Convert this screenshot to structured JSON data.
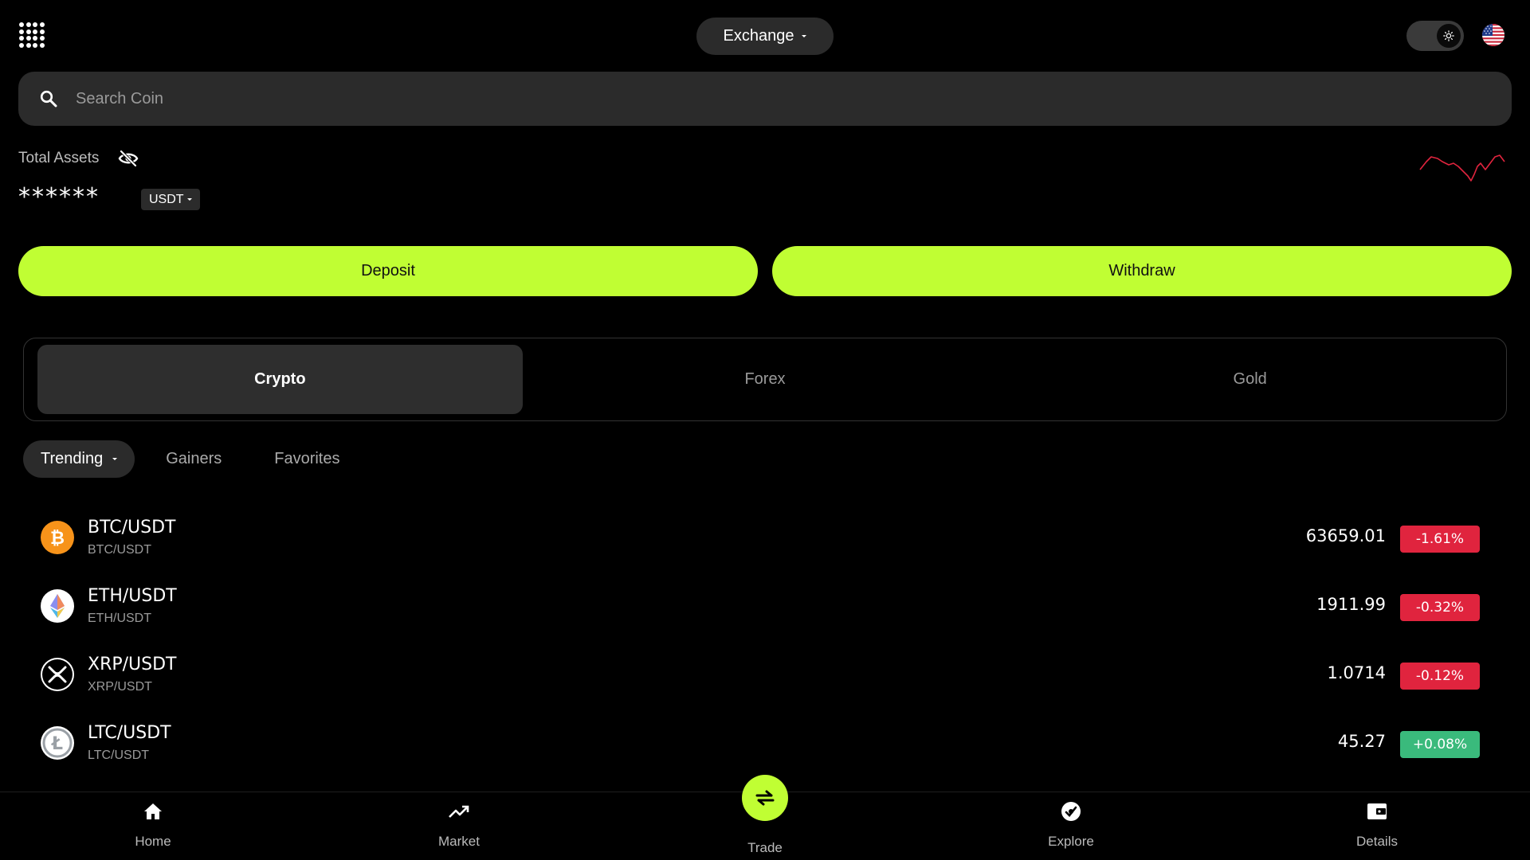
{
  "header": {
    "exchange_label": "Exchange",
    "icons": {
      "apps": "apps-grid-icon",
      "theme": "sun-icon",
      "language": "us-flag-icon"
    }
  },
  "search": {
    "placeholder": "Search Coin",
    "value": ""
  },
  "assets": {
    "label": "Total Assets",
    "value_masked": "******",
    "currency": "USDT"
  },
  "actions": {
    "deposit": "Deposit",
    "withdraw": "Withdraw"
  },
  "market_tabs": [
    {
      "label": "Crypto",
      "active": true
    },
    {
      "label": "Forex",
      "active": false
    },
    {
      "label": "Gold",
      "active": false
    }
  ],
  "filters": [
    {
      "label": "Trending",
      "active": true
    },
    {
      "label": "Gainers",
      "active": false
    },
    {
      "label": "Favorites",
      "active": false
    }
  ],
  "coins": [
    {
      "pair": "BTC/USDT",
      "sub": "BTC/USDT",
      "price": "63659.01",
      "change": "-1.61%",
      "direction": "down",
      "icon": "bitcoin-icon"
    },
    {
      "pair": "ETH/USDT",
      "sub": "ETH/USDT",
      "price": "1911.99",
      "change": "-0.32%",
      "direction": "down",
      "icon": "ethereum-icon"
    },
    {
      "pair": "XRP/USDT",
      "sub": "XRP/USDT",
      "price": "1.0714",
      "change": "-0.12%",
      "direction": "down",
      "icon": "xrp-icon"
    },
    {
      "pair": "LTC/USDT",
      "sub": "LTC/USDT",
      "price": "45.27",
      "change": "+0.08%",
      "direction": "up",
      "icon": "litecoin-icon"
    }
  ],
  "bottom_nav": [
    {
      "label": "Home",
      "icon": "home-icon"
    },
    {
      "label": "Market",
      "icon": "trending-up-icon"
    },
    {
      "label": "Trade",
      "icon": "swap-icon"
    },
    {
      "label": "Explore",
      "icon": "explore-icon"
    },
    {
      "label": "Details",
      "icon": "wallet-icon"
    }
  ],
  "colors": {
    "accent": "#c0fe33",
    "negative": "#e0243e",
    "positive": "#3aba7c",
    "surface": "#2b2b2b",
    "background": "#000000",
    "sparkline": "#e0243e"
  }
}
